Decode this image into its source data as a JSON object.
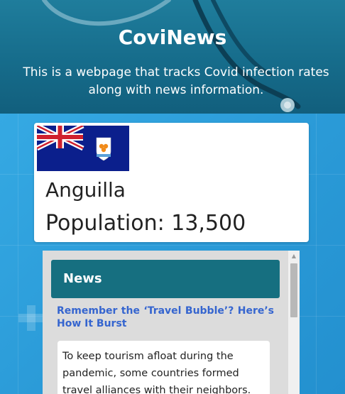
{
  "header": {
    "title": "CoviNews",
    "subtitle": "This is a webpage that tracks Covid infection rates along with news information."
  },
  "country": {
    "flag_icon": "anguilla-flag-icon",
    "name": "Anguilla",
    "population": "Population: 13,500"
  },
  "news": {
    "heading": "News",
    "article_title": "Remember the ‘Travel Bubble’? Here’s How It Burst",
    "article_excerpt": "To keep tourism afloat during the pandemic, some countries formed travel alliances with their neighbors. At"
  },
  "colors": {
    "header_bg": "#166c8b",
    "page_bg": "#2f9fd6",
    "news_header_bg": "#166f80",
    "link_color": "#3565cf"
  }
}
